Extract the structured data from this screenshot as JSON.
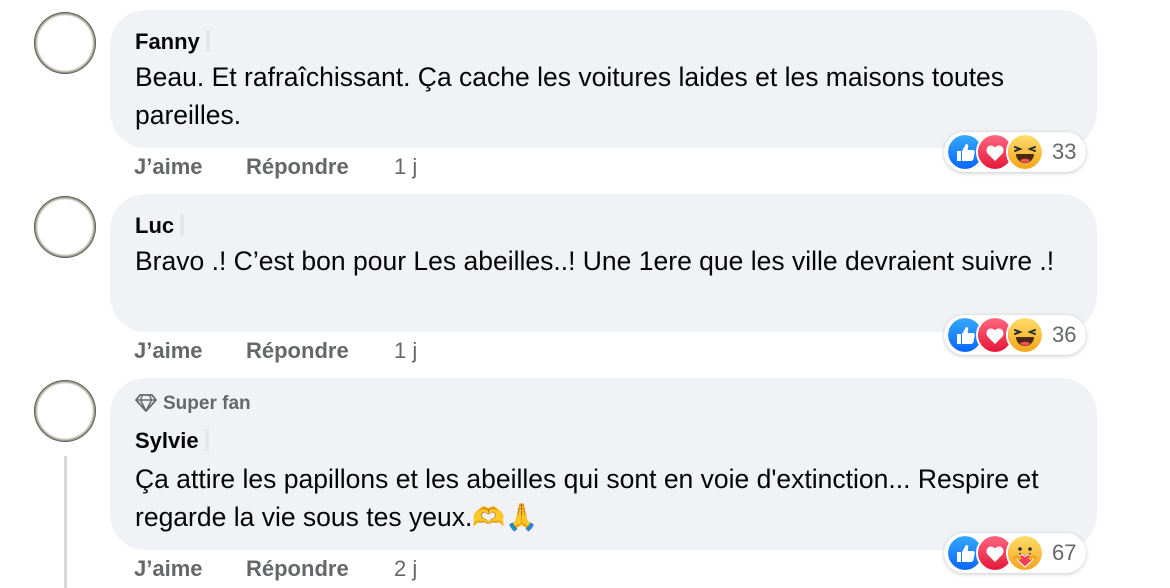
{
  "comments": [
    {
      "author": "Fanny",
      "text": "Beau. Et rafraîchissant. Ça cache les voitures laides et les maisons toutes pareilles.",
      "like_label": "J’aime",
      "reply_label": "Répondre",
      "time": "1 j",
      "reaction_count": "33",
      "reactions": [
        "like-icon",
        "love-icon",
        "haha-icon"
      ]
    },
    {
      "author": "Luc",
      "text": "Bravo .! C’est bon pour Les abeilles..! Une 1ere que les ville devraient suivre .!",
      "like_label": "J’aime",
      "reply_label": "Répondre",
      "time": "1 j",
      "reaction_count": "36",
      "reactions": [
        "like-icon",
        "love-icon",
        "haha-icon"
      ]
    },
    {
      "badge": "Super fan",
      "author": "Sylvie",
      "text": "Ça attire les papillons et les abeilles qui sont en voie d'extinction... Respire et regarde la vie sous tes yeux.🫶🙏",
      "like_label": "J’aime",
      "reply_label": "Répondre",
      "time": "2 j",
      "reaction_count": "67",
      "reactions": [
        "like-icon",
        "love-icon",
        "care-icon"
      ]
    }
  ],
  "colors": {
    "bubble": "#f0f2f5",
    "like_blue": "#1877f2",
    "love_red": "#f33e58",
    "haha_yellow": "#f7b125",
    "muted_text": "#65676b"
  }
}
